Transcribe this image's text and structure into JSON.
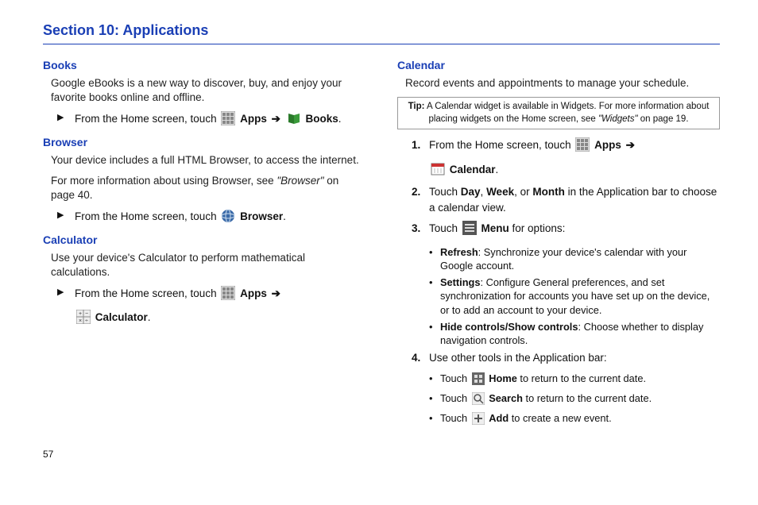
{
  "section_title": "Section 10: Applications",
  "page_number": "57",
  "arrow": "➔",
  "books": {
    "head": "Books",
    "intro": "Google eBooks is a new way to discover, buy, and enjoy your favorite books online and offline.",
    "step_pre": "From the Home screen, touch ",
    "apps": "Apps",
    "label": "Books",
    "period": "."
  },
  "browser": {
    "head": "Browser",
    "intro": "Your device includes a full HTML Browser, to access the internet.",
    "more_pre": "For more information about using Browser, see ",
    "more_link": "\"Browser\"",
    "more_post": " on page 40.",
    "step_pre": "From the Home screen, touch ",
    "label": "Browser",
    "period": "."
  },
  "calculator": {
    "head": "Calculator",
    "intro": "Use your device's Calculator to perform mathematical calculations.",
    "step_pre": "From the Home screen, touch ",
    "apps": "Apps",
    "label": "Calculator",
    "period": "."
  },
  "calendar": {
    "head": "Calendar",
    "intro": "Record events and appointments to manage your schedule.",
    "tip_label": "Tip:",
    "tip_body_pre": " A Calendar widget is available in Widgets. For more information about placing widgets on the Home screen, see ",
    "tip_link": "\"Widgets\"",
    "tip_body_post": " on page 19.",
    "s1_num": "1.",
    "s1_pre": "From the Home screen, touch ",
    "s1_apps": "Apps",
    "s1_label": "Calendar",
    "s1_period": ".",
    "s2_num": "2.",
    "s2_pre": "Touch ",
    "s2_day": "Day",
    "s2_c1": ", ",
    "s2_week": "Week",
    "s2_c2": ", or ",
    "s2_month": "Month",
    "s2_post": " in the Application bar to choose a calendar view.",
    "s3_num": "3.",
    "s3_pre": "Touch ",
    "s3_menu": "Menu",
    "s3_post": " for options:",
    "b1_label": "Refresh",
    "b1_post": ": Synchronize your device's calendar with your Google account.",
    "b2_label": "Settings",
    "b2_post": ": Configure General preferences, and set synchronization for accounts you have set up on the device, or to add an account to your device.",
    "b3_label": "Hide controls/Show controls",
    "b3_post": ": Choose whether to display navigation controls.",
    "s4_num": "4.",
    "s4_text": "Use other tools in the Application bar:",
    "t1_pre": "Touch ",
    "t1_label": "Home",
    "t1_post": " to return to the current date.",
    "t2_pre": "Touch ",
    "t2_label": "Search",
    "t2_post": " to return to the current date.",
    "t3_pre": "Touch ",
    "t3_label": "Add",
    "t3_post": " to create a new event."
  }
}
